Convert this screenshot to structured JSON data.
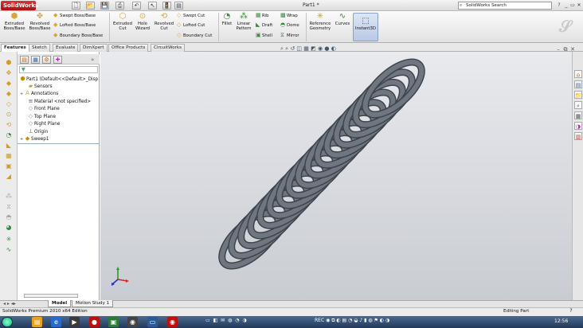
{
  "app": {
    "logo_text": "SolidWorks",
    "document_title": "Part1 *",
    "search_placeholder": "SolidWorks Search",
    "help_label": "?",
    "win_minimize": "_",
    "win_restore": "▭",
    "win_close": "✕"
  },
  "ribbon": {
    "extruded_boss": "Extruded\nBoss/Base",
    "revolved_boss": "Revolved\nBoss/Base",
    "swept_boss": "Swept Boss/Base",
    "lofted_boss": "Lofted Boss/Base",
    "boundary_boss": "Boundary Boss/Base",
    "extruded_cut": "Extruded\nCut",
    "hole_wizard": "Hole\nWizard",
    "revolved_cut": "Revolved\nCut",
    "swept_cut": "Swept Cut",
    "lofted_cut": "Lofted Cut",
    "boundary_cut": "Boundary Cut",
    "fillet": "Fillet",
    "linear_pattern": "Linear\nPattern",
    "rib": "Rib",
    "draft": "Draft",
    "shell": "Shell",
    "wrap": "Wrap",
    "dome": "Dome",
    "mirror": "Mirror",
    "reference_geometry": "Reference\nGeometry",
    "curves": "Curves",
    "instant3d": "Instant3D"
  },
  "command_tabs": [
    "Features",
    "Sketch",
    "Evaluate",
    "DimXpert",
    "Office Products",
    "CircuitWorks"
  ],
  "feature_tree": {
    "root": "Part1  (Default<<Default>_Disp",
    "items": [
      "Sensors",
      "Annotations",
      "Material <not specified>",
      "Front Plane",
      "Top Plane",
      "Right Plane",
      "Origin",
      "Sweep1"
    ]
  },
  "model_tabs": [
    "Model",
    "Motion Study 1"
  ],
  "status": {
    "left": "SolidWorks Premium 2010 x64 Edition",
    "right": "Editing Part",
    "help": "?"
  },
  "taskbar": {
    "tray_text": "REC",
    "clock": "12:56"
  },
  "colors": {
    "spring": "#6f7680",
    "viewport_top": "#e8eaee",
    "viewport_bottom": "#c9ccd2",
    "logo": "#c01f1f"
  }
}
